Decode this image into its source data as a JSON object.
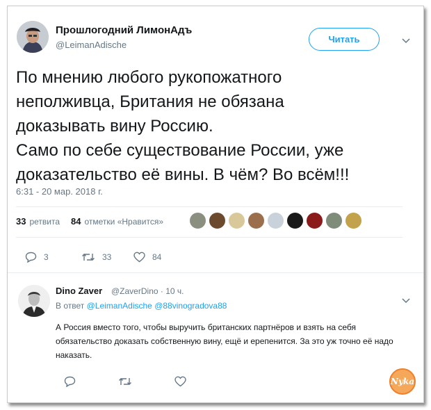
{
  "tweet": {
    "display_name": "Прошлогодний ЛимонАдъ",
    "handle": "@LeimanAdische",
    "follow_label": "Читать",
    "text": "По мнению любого рукопожатного\nнеполживца, Британия не обязана\nдоказывать вину Россию.\nСамо по себе существование России, уже\nдоказательство её вины. В чём? Во всём!!!",
    "timestamp": "6:31 - 20 мар. 2018 г.",
    "retweets_count": "33",
    "retweets_label": "ретвита",
    "likes_count": "84",
    "likes_label": "отметки «Нравится»",
    "actions": {
      "replies": "3",
      "retweets": "33",
      "likes": "84"
    }
  },
  "reply": {
    "display_name": "Dino Zaver",
    "meta": "@ZaverDino · 10 ч.",
    "in_reply_prefix": "В ответ",
    "mention_1": "@LeimanAdische",
    "mention_2": "@88vinogradova88",
    "text": "А Россия вместо того, чтобы выручить британских партнёров и взять на себя обязательство доказать собственную вину, ещё и ерепенится. За это уж точно её надо наказать."
  },
  "watermark": {
    "text": "Nyka"
  },
  "colors": {
    "accent": "#1da1f2",
    "muted": "#657786",
    "text": "#14171a",
    "divider": "#e6ecf0"
  },
  "icons": [
    "chevron-down-icon",
    "reply-icon",
    "retweet-icon",
    "heart-icon"
  ]
}
